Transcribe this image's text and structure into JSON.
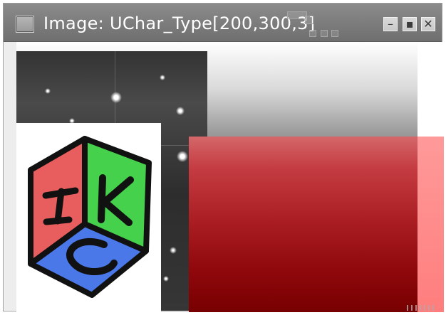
{
  "window": {
    "title": "Image: UChar_Type[200,300,3]"
  },
  "titlebar_buttons": {
    "minimize_label": "–",
    "maximize_label": "▪",
    "close_label": "✕"
  },
  "icons": {
    "checkbox": "checkbox-icon",
    "minimize": "minimize-icon",
    "maximize": "maximize-icon",
    "close": "close-icon",
    "logo": "ikc-cube-logo-icon"
  },
  "colors": {
    "titlebar": "#7b7b7b",
    "canvas_red": "#9f1d22",
    "canvas_gray": "#d9d9d9",
    "logo_red": "#e85d5d",
    "logo_green": "#46d14c",
    "logo_blue": "#4a78e8"
  }
}
